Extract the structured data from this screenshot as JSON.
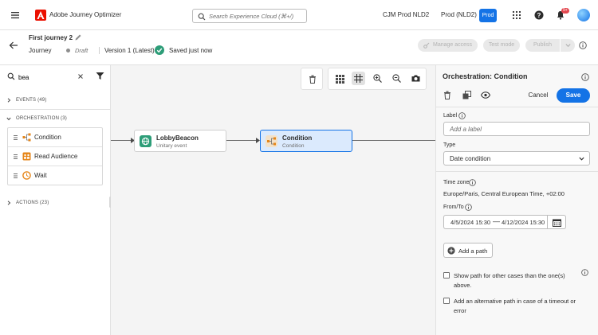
{
  "app": {
    "title": "Adobe Journey Optimizer"
  },
  "search": {
    "placeholder": "Search Experience Cloud (⌘+/)"
  },
  "org": {
    "name": "CJM Prod NLD2",
    "sandbox": "Prod (NLD2)",
    "env_badge": "Prod"
  },
  "notifications": {
    "count": "9+"
  },
  "journey": {
    "name": "First journey 2",
    "breadcrumb": "Journey",
    "status": "Draft",
    "version": "Version 1 (Latest)",
    "saved": "Saved just now",
    "actions": {
      "manage_access": "Manage access",
      "test_mode": "Test mode",
      "publish": "Publish"
    }
  },
  "left_panel": {
    "search_value": "bea",
    "sections": {
      "events": "EVENTS (49)",
      "orchestration": "ORCHESTRATION (3)",
      "actions": "ACTIONS (23)"
    },
    "orchestration_items": [
      {
        "label": "Condition",
        "icon": "condition-icon"
      },
      {
        "label": "Read Audience",
        "icon": "read-audience-icon"
      },
      {
        "label": "Wait",
        "icon": "wait-clock-icon"
      }
    ]
  },
  "canvas": {
    "nodes": [
      {
        "title": "LobbyBeacon",
        "subtitle": "Unitary event",
        "icon": "event-globe-icon"
      },
      {
        "title": "Condition",
        "subtitle": "Condition",
        "icon": "condition-icon"
      }
    ]
  },
  "right_panel": {
    "title": "Orchestration: Condition",
    "cancel": "Cancel",
    "save": "Save",
    "label_field": {
      "label": "Label",
      "placeholder": "Add a label",
      "value": ""
    },
    "type_field": {
      "label": "Type",
      "value": "Date condition"
    },
    "timezone": {
      "label": "Time zone",
      "value": "Europe/Paris, Central European Time, +02:00"
    },
    "from_to": {
      "label": "From/To",
      "from": "4/5/2024 15:30",
      "separator": "—",
      "to": "4/12/2024 15:30"
    },
    "add_path": "Add a path",
    "options": [
      {
        "label": "Show path for other cases than the one(s) above.",
        "checked": false
      },
      {
        "label": "Add an alternative path in case of a timeout or error",
        "checked": false
      }
    ]
  },
  "colors": {
    "accent": "#1473e6",
    "brand": "#eb1000",
    "success": "#2d9d78",
    "canvas_bg": "#f4f4f4"
  }
}
